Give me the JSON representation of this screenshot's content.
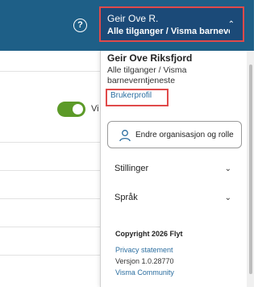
{
  "header": {
    "help_icon": "help-icon",
    "user_button": {
      "name": "Geir Ove R.",
      "org": "Alle tilganger / Visma barnevernt...",
      "chevron": "chevron-up-icon"
    }
  },
  "background": {
    "toggle_state": "on",
    "toggle_label": "Vi"
  },
  "panel": {
    "full_name": "Geir Ove Riksfjord",
    "org_full": "Alle tilganger / Visma barneverntjeneste",
    "profile_link": "Brukerprofil",
    "change_button": "Endre organisasjon og rolle",
    "menu": [
      {
        "label": "Stillinger",
        "chevron": "chevron-down-icon"
      },
      {
        "label": "Språk",
        "chevron": "chevron-down-icon"
      }
    ],
    "footer": {
      "copyright": "Copyright 2026 Flyt",
      "privacy": "Privacy statement",
      "version": "Versjon 1.0.28770",
      "community": "Visma Community"
    }
  },
  "colors": {
    "topbar": "#1e5f87",
    "user_button_bg": "#1b4a78",
    "highlight_border": "#e04a4a",
    "link": "#2b6ea0",
    "toggle": "#5c9a28"
  }
}
